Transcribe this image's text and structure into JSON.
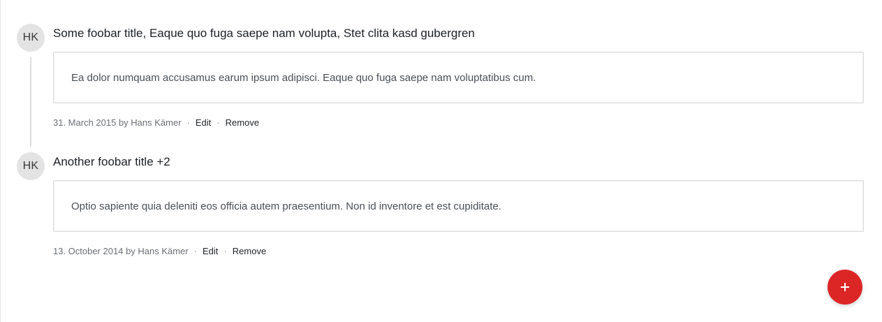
{
  "entries": [
    {
      "avatar_initials": "HK",
      "title": "Some foobar title, Eaque quo fuga saepe nam volupta, Stet clita kasd gubergren",
      "body": "Ea dolor numquam accusamus earum ipsum adipisci. Eaque quo fuga saepe nam voluptatibus cum.",
      "meta": "31. March 2015 by Hans Kämer",
      "separator": "·",
      "edit_label": "Edit",
      "remove_label": "Remove"
    },
    {
      "avatar_initials": "HK",
      "title": "Another foobar title +2",
      "body": "Optio sapiente quia deleniti eos officia autem praesentium. Non id inventore et est cupiditate.",
      "meta": "13. October 2014 by Hans Kämer",
      "separator": "·",
      "edit_label": "Edit",
      "remove_label": "Remove"
    }
  ],
  "fab": {
    "icon": "plus-icon",
    "color": "#dc2626"
  },
  "colors": {
    "avatar_bg": "#e3e3e3",
    "card_border": "#dcdcdc",
    "timeline_line": "#dddddd",
    "fab": "#dc2626"
  }
}
